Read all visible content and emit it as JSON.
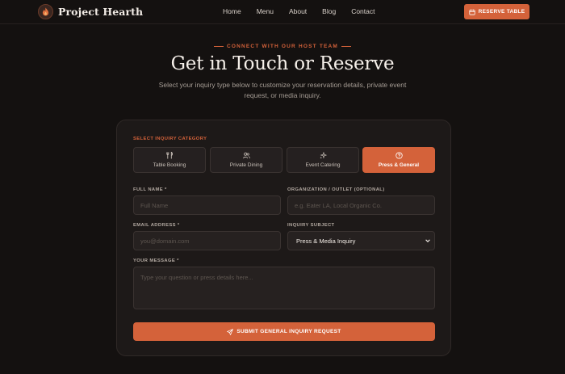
{
  "nav": {
    "brand": "Project Hearth",
    "links": [
      "Home",
      "Menu",
      "About",
      "Blog",
      "Contact"
    ],
    "reserve_label": "RESERVE TABLE"
  },
  "hero": {
    "eyebrow": "CONNECT WITH OUR HOST TEAM",
    "title": "Get in Touch or Reserve",
    "subtitle": "Select your inquiry type below to customize your reservation details, private event request, or media inquiry."
  },
  "form": {
    "category_label": "SELECT INQUIRY CATEGORY",
    "categories": [
      {
        "label": "Table Booking",
        "icon": "utensils-icon",
        "active": false
      },
      {
        "label": "Private Dining",
        "icon": "people-icon",
        "active": false
      },
      {
        "label": "Event Catering",
        "icon": "sparkle-icon",
        "active": false
      },
      {
        "label": "Press & General",
        "icon": "help-circle-icon",
        "active": true
      }
    ],
    "full_name": {
      "label": "FULL NAME *",
      "placeholder": "Full Name",
      "value": ""
    },
    "organization": {
      "label": "ORGANIZATION / OUTLET (OPTIONAL)",
      "placeholder": "e.g. Eater LA, Local Organic Co.",
      "value": ""
    },
    "email": {
      "label": "EMAIL ADDRESS *",
      "placeholder": "you@domain.com",
      "value": ""
    },
    "subject": {
      "label": "INQUIRY SUBJECT",
      "selected": "Press & Media Inquiry"
    },
    "message": {
      "label": "YOUR MESSAGE *",
      "placeholder": "Type your question or press details here...",
      "value": ""
    },
    "submit_label": "SUBMIT GENERAL INQUIRY REQUEST"
  },
  "colors": {
    "accent": "#d4623a",
    "background": "#141110",
    "card": "#1d1918"
  }
}
